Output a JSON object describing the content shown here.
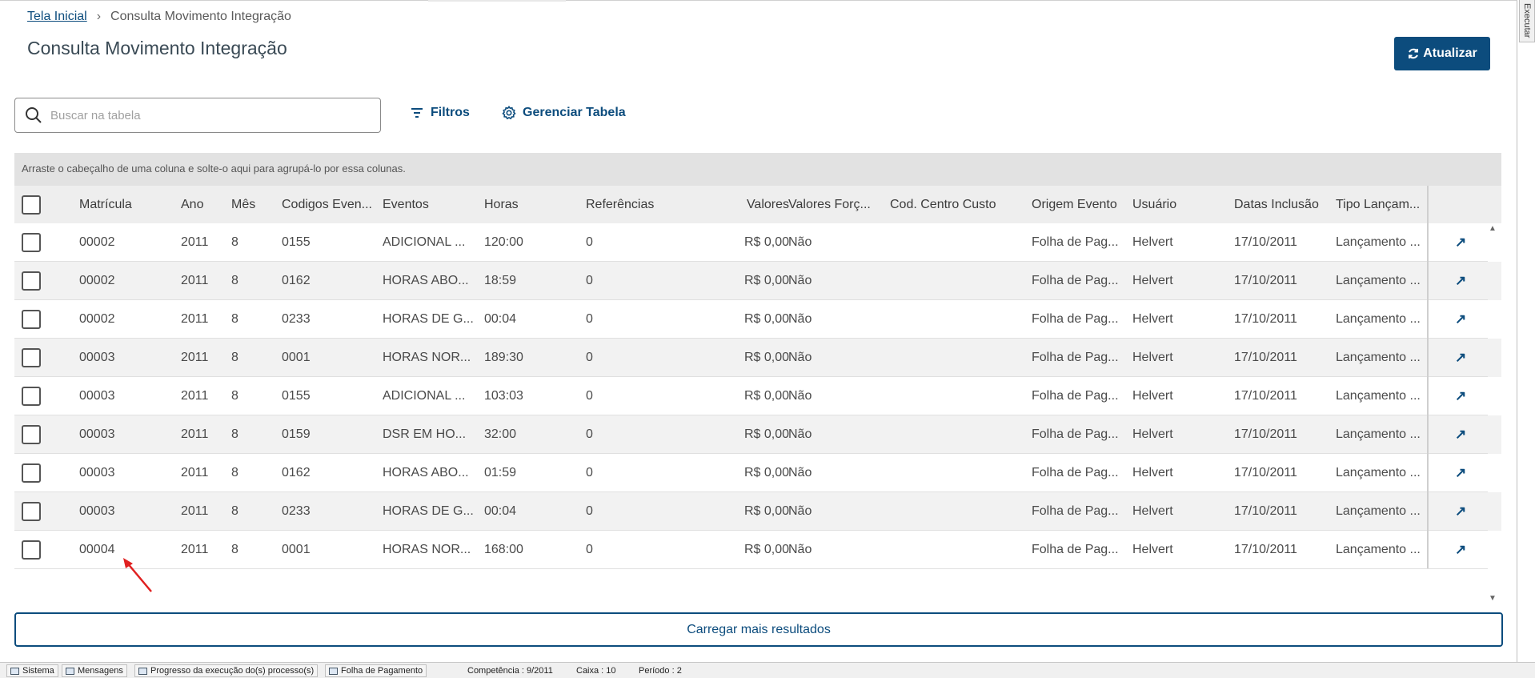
{
  "breadcrumb": {
    "home": "Tela Inicial",
    "current": "Consulta Movimento Integração"
  },
  "page_title": "Consulta Movimento Integração",
  "toolbar": {
    "update_label": "Atualizar",
    "filters_label": "Filtros",
    "manage_label": "Gerenciar Tabela"
  },
  "search": {
    "placeholder": "Buscar na tabela",
    "value": ""
  },
  "group_hint": "Arraste o cabeçalho de uma coluna e solte-o aqui para agrupá-lo por essa colunas.",
  "table": {
    "columns": [
      "Matrícula",
      "Ano",
      "Mês",
      "Codigos Even...",
      "Eventos",
      "Horas",
      "Referências",
      "Valores",
      "Valores Forç...",
      "Cod. Centro Custo",
      "Origem Evento",
      "Usuário",
      "Datas Inclusão",
      "Tipo Lançam..."
    ],
    "rows": [
      [
        "00002",
        "2011",
        "8",
        "0155",
        "ADICIONAL ...",
        "120:00",
        "0",
        "R$ 0,00",
        "Não",
        "",
        "Folha de Pag...",
        "Helvert",
        "17/10/2011",
        "Lançamento ..."
      ],
      [
        "00002",
        "2011",
        "8",
        "0162",
        "HORAS ABO...",
        "18:59",
        "0",
        "R$ 0,00",
        "Não",
        "",
        "Folha de Pag...",
        "Helvert",
        "17/10/2011",
        "Lançamento ..."
      ],
      [
        "00002",
        "2011",
        "8",
        "0233",
        "HORAS DE G...",
        "00:04",
        "0",
        "R$ 0,00",
        "Não",
        "",
        "Folha de Pag...",
        "Helvert",
        "17/10/2011",
        "Lançamento ..."
      ],
      [
        "00003",
        "2011",
        "8",
        "0001",
        "HORAS NOR...",
        "189:30",
        "0",
        "R$ 0,00",
        "Não",
        "",
        "Folha de Pag...",
        "Helvert",
        "17/10/2011",
        "Lançamento ..."
      ],
      [
        "00003",
        "2011",
        "8",
        "0155",
        "ADICIONAL ...",
        "103:03",
        "0",
        "R$ 0,00",
        "Não",
        "",
        "Folha de Pag...",
        "Helvert",
        "17/10/2011",
        "Lançamento ..."
      ],
      [
        "00003",
        "2011",
        "8",
        "0159",
        "DSR EM HO...",
        "32:00",
        "0",
        "R$ 0,00",
        "Não",
        "",
        "Folha de Pag...",
        "Helvert",
        "17/10/2011",
        "Lançamento ..."
      ],
      [
        "00003",
        "2011",
        "8",
        "0162",
        "HORAS ABO...",
        "01:59",
        "0",
        "R$ 0,00",
        "Não",
        "",
        "Folha de Pag...",
        "Helvert",
        "17/10/2011",
        "Lançamento ..."
      ],
      [
        "00003",
        "2011",
        "8",
        "0233",
        "HORAS DE G...",
        "00:04",
        "0",
        "R$ 0,00",
        "Não",
        "",
        "Folha de Pag...",
        "Helvert",
        "17/10/2011",
        "Lançamento ..."
      ],
      [
        "00004",
        "2011",
        "8",
        "0001",
        "HORAS NOR...",
        "168:00",
        "0",
        "R$ 0,00",
        "Não",
        "",
        "Folha de Pag...",
        "Helvert",
        "17/10/2011",
        "Lançamento ..."
      ]
    ]
  },
  "load_more_label": "Carregar mais resultados",
  "side_tab_label": "Executar",
  "statusbar": {
    "sistema": "Sistema",
    "mensagens": "Mensagens",
    "progresso": "Progresso da execução do(s) processo(s)",
    "folha": "Folha de Pagamento",
    "competencia": "Competência : 9/2011",
    "caixa": "Caixa : 10",
    "periodo": "Período : 2"
  },
  "colors": {
    "primary": "#0c4c7d",
    "annotation_arrow": "#e02020"
  }
}
